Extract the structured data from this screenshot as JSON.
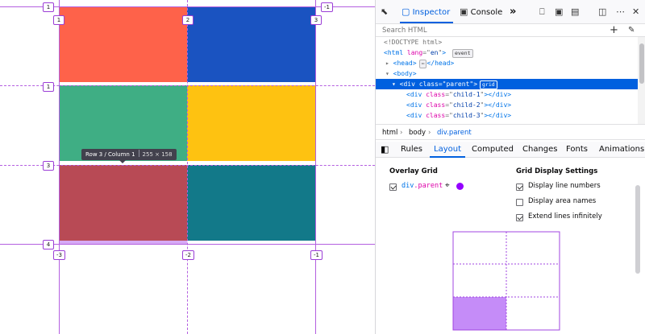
{
  "grid": {
    "colors": {
      "r1c1": "#fe624a",
      "r1c2": "#1a53c1",
      "r2c1": "#3fae84",
      "r2c2": "#fec211",
      "r3c1": "#b84a55",
      "r3c2": "#127989",
      "line": "#b45fe0",
      "highlight": "#cf9bf3"
    },
    "line_numbers": {
      "col_top": [
        "1",
        "2",
        "3"
      ],
      "col_top_right": "-1",
      "col_bottom": [
        "-3",
        "-2",
        "-1"
      ],
      "rows": [
        "1",
        "2",
        "3",
        "4"
      ]
    },
    "tooltip": {
      "label": "Row 3 / Column 1",
      "dims": "255 × 158"
    }
  },
  "devtools": {
    "toolbar": {
      "inspector_label": "Inspector",
      "console_label": "Console",
      "more_label": "»"
    },
    "search": {
      "placeholder": "Search HTML"
    },
    "markup": {
      "doctype": "<!DOCTYPE html>",
      "html_lang": "en",
      "event_badge": "event",
      "grid_badge": "grid",
      "parent_class": "parent",
      "children": [
        "child-1",
        "child-2",
        "child-3"
      ]
    },
    "breadcrumbs": [
      "html",
      "body",
      "div.parent"
    ],
    "sidebar_tabs": [
      "Rules",
      "Layout",
      "Computed",
      "Changes",
      "Fonts",
      "Animations"
    ],
    "layout": {
      "overlay_grid_title": "Overlay Grid",
      "grid_item_tag": "div",
      "grid_item_class": ".parent",
      "grid_item_color": "#9400ff",
      "display_settings_title": "Grid Display Settings",
      "options": [
        {
          "label": "Display line numbers",
          "checked": true
        },
        {
          "label": "Display area names",
          "checked": false
        },
        {
          "label": "Extend lines infinitely",
          "checked": true
        }
      ],
      "outline": {
        "rows": 3,
        "cols": 2,
        "highlight_row": 3,
        "highlight_col": 1
      }
    }
  }
}
